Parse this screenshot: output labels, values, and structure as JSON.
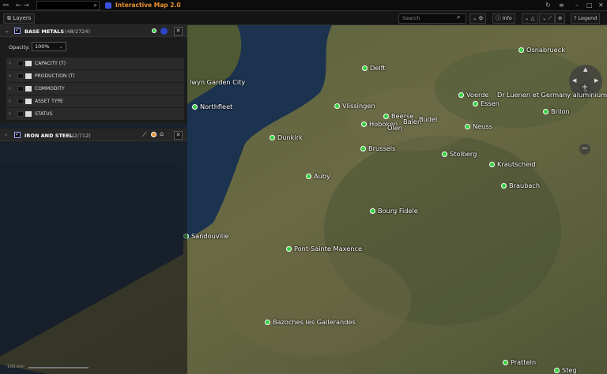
{
  "titlebar": {
    "app_title": "Interactive Map 2.0"
  },
  "toolbar": {
    "layers_label": "Layers",
    "search_placeholder": "Search",
    "info_label": "Info",
    "legend_label": "Legend"
  },
  "panel": {
    "base_metals": {
      "title": "BASE METALS",
      "count": "(48/2724)",
      "opacity_label": "Opacity:",
      "opacity_value": "100%",
      "rows": [
        "CAPACITY (T)",
        "PRODUCTION (T)",
        "COMMODITY",
        "ASSET TYPE",
        "STATUS"
      ]
    },
    "iron_steel": {
      "title": "IRON AND STEEL",
      "count": "(2/712)"
    }
  },
  "map": {
    "scale_label": "100 km",
    "places": [
      "Osnabrueck",
      "Delft",
      "lwyn Garden City",
      "Northfleet",
      "Vlissingen",
      "Voerde",
      "Dr",
      "Luenen et Germany aluminium s",
      "Essen",
      "Brilon",
      "Beerse",
      "Hoboken",
      "Balen",
      "Budel",
      "Olen",
      "Neuss",
      "Dunkirk",
      "Brussels",
      "Stolberg",
      "Krautscheid",
      "Auby",
      "Braubach",
      "Bourg Fidele",
      "Sandouville",
      "Pont-Sainte Maxence",
      "Bazoches les Gallerandes",
      "Pratteln",
      "Steg"
    ]
  },
  "colors": {
    "accent": "#e8902e",
    "marker": "#2fd23d",
    "brand": "#3b52e0"
  },
  "icons": [
    "link-icon",
    "back-icon",
    "forward-icon",
    "search-icon",
    "refresh-icon",
    "menu-icon",
    "minimize-icon",
    "maximize-icon",
    "close-icon",
    "info-icon",
    "globe-icon",
    "help-icon"
  ]
}
